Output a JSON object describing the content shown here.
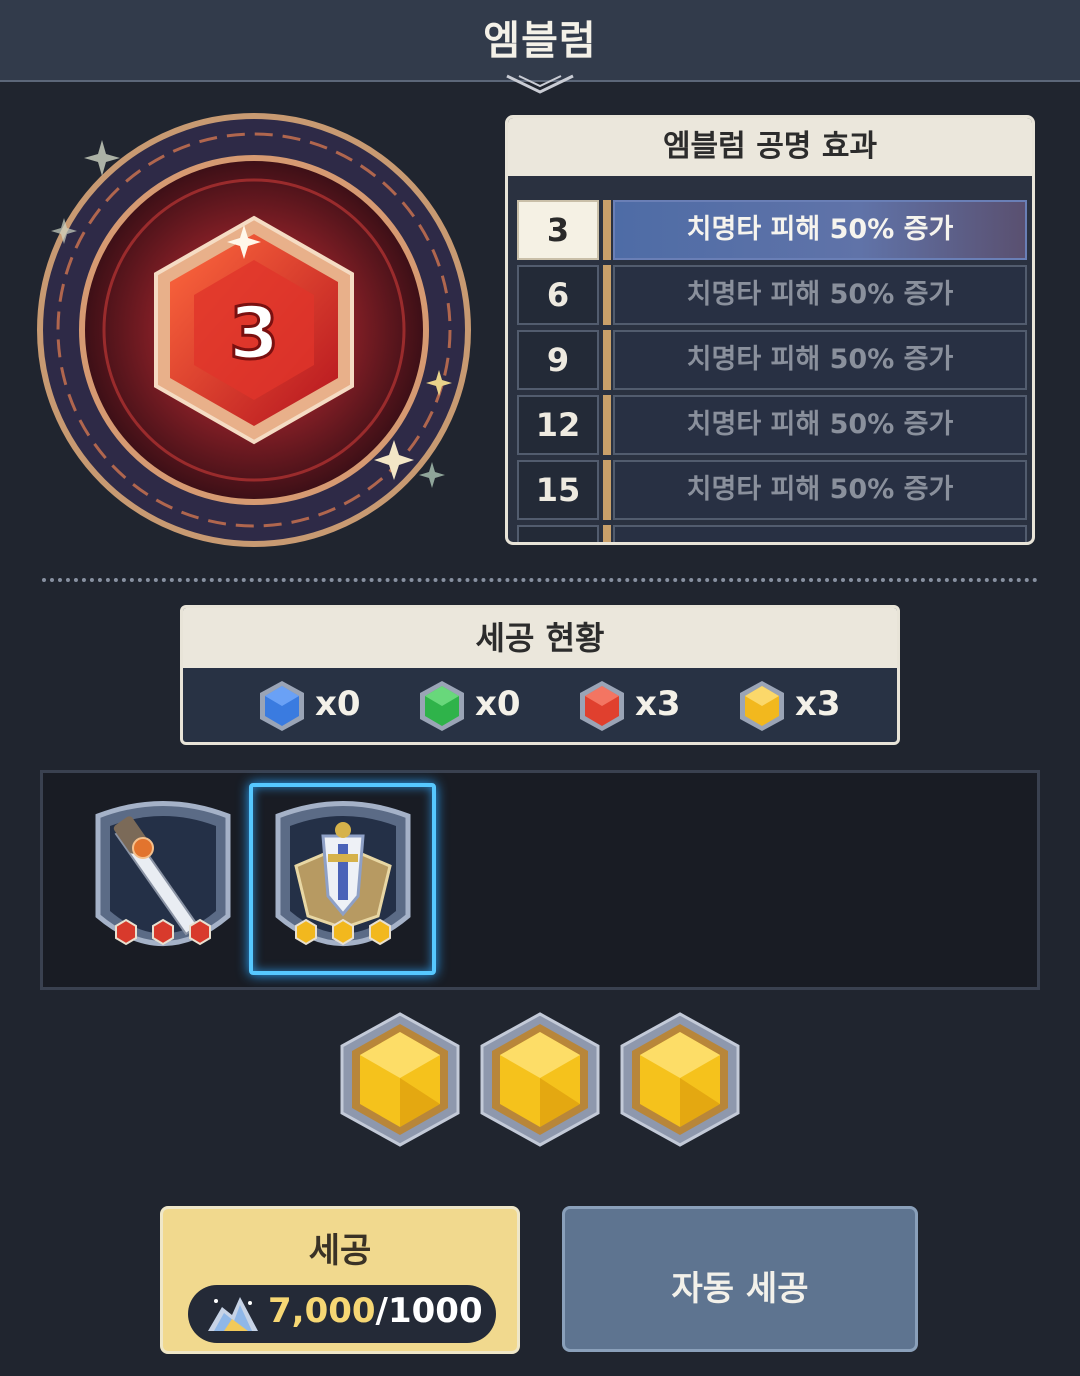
{
  "header": {
    "title": "엠블럼"
  },
  "emblem": {
    "level": "3"
  },
  "resonance": {
    "title": "엠블럼 공명 효과",
    "rows": [
      {
        "level": "3",
        "effect": "치명타 피해 50% 증가",
        "active": true
      },
      {
        "level": "6",
        "effect": "치명타 피해 50% 증가",
        "active": false
      },
      {
        "level": "9",
        "effect": "치명타 피해 50% 증가",
        "active": false
      },
      {
        "level": "12",
        "effect": "치명타 피해 50% 증가",
        "active": false
      },
      {
        "level": "15",
        "effect": "치명타 피해 50% 증가",
        "active": false
      }
    ]
  },
  "socket_status": {
    "title": "세공 현황",
    "gems": [
      {
        "color": "blue",
        "hex": "#3a7be0",
        "count": "x0"
      },
      {
        "color": "green",
        "hex": "#2fb34a",
        "count": "x0"
      },
      {
        "color": "red",
        "hex": "#e0402e",
        "count": "x3"
      },
      {
        "color": "yellow",
        "hex": "#f2b81e",
        "count": "x3"
      }
    ]
  },
  "items": [
    {
      "name": "sword-emblem",
      "gem_color": "red",
      "selected": false
    },
    {
      "name": "shield-emblem",
      "gem_color": "yellow",
      "selected": true
    }
  ],
  "slots": {
    "gem_color": "yellow",
    "count": 3
  },
  "buttons": {
    "socket_label": "세공",
    "cost_have": "7,000",
    "cost_sep": "/",
    "cost_need": "1000",
    "auto_label": "자동 세공"
  },
  "colors": {
    "accent": "#f1d98e",
    "selected": "#56c8ff",
    "panel_header": "#ebe7dc"
  }
}
